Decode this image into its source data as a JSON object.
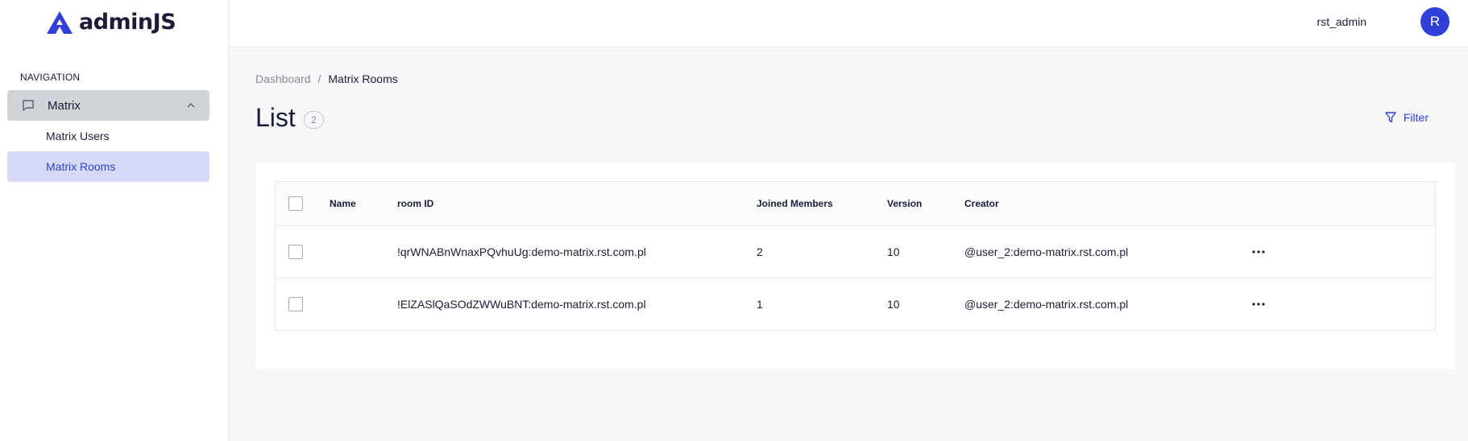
{
  "brand": {
    "name": "adminJS",
    "accent": "#3040d6"
  },
  "sidebar": {
    "heading": "NAVIGATION",
    "parent": {
      "label": "Matrix",
      "icon": "chat-bubble-icon",
      "expanded": true
    },
    "items": [
      {
        "label": "Matrix Users",
        "active": false
      },
      {
        "label": "Matrix Rooms",
        "active": true
      }
    ]
  },
  "topbar": {
    "username": "rst_admin",
    "avatar_initial": "R"
  },
  "breadcrumb": {
    "root": "Dashboard",
    "separator": "/",
    "current": "Matrix Rooms"
  },
  "page": {
    "title": "List",
    "count": "2",
    "filter_label": "Filter"
  },
  "table": {
    "columns": [
      "Name",
      "room ID",
      "Joined Members",
      "Version",
      "Creator"
    ],
    "rows": [
      {
        "name": "",
        "room_id": "!qrWNABnWnaxPQvhuUg:demo-matrix.rst.com.pl",
        "joined_members": "2",
        "version": "10",
        "creator": "@user_2:demo-matrix.rst.com.pl"
      },
      {
        "name": "",
        "room_id": "!ElZASlQaSOdZWWuBNT:demo-matrix.rst.com.pl",
        "joined_members": "1",
        "version": "10",
        "creator": "@user_2:demo-matrix.rst.com.pl"
      }
    ]
  }
}
